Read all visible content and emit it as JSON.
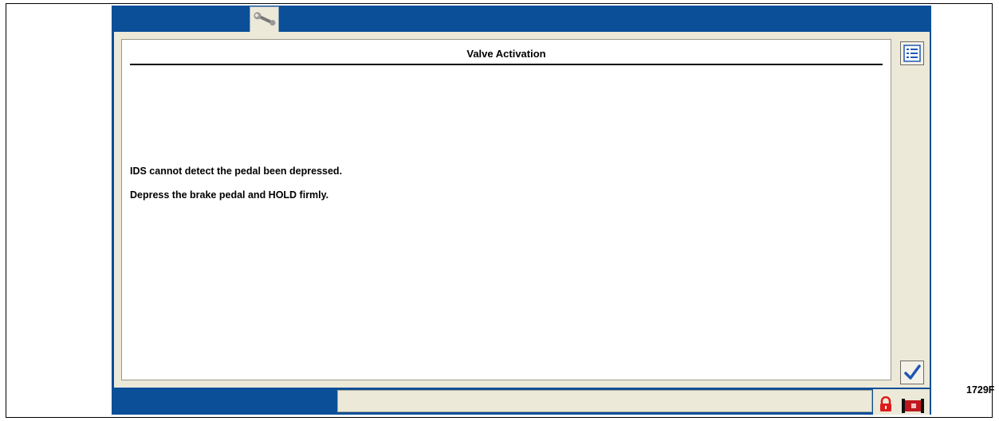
{
  "window": {
    "tab_icon": "wrench-icon"
  },
  "panel": {
    "title": "Valve Activation",
    "messages": [
      "IDS cannot detect the pedal been depressed.",
      "Depress the brake pedal and HOLD firmly."
    ]
  },
  "sidebar": {
    "menu_icon": "list-menu-icon",
    "confirm_icon": "checkmark-icon"
  },
  "statusbar": {
    "text": "",
    "lock_icon": "lock-icon",
    "flag_icon": "flag-icon"
  },
  "figure_label": "1729F",
  "colors": {
    "frame_blue": "#0a4f97",
    "panel_beige": "#ece9d8",
    "check_blue": "#1f57b4",
    "lock_red": "#e01b1b"
  }
}
